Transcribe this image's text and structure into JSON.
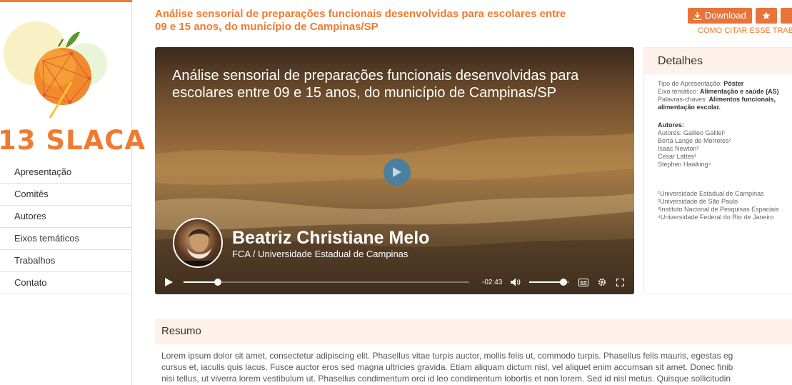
{
  "sidebar": {
    "logo_text": "13 SLACA",
    "nav": [
      "Apresentação",
      "Comitês",
      "Autores",
      "Eixos temáticos",
      "Trabalhos",
      "Contato"
    ]
  },
  "header": {
    "title": "Análise sensorial de preparações funcionais desenvolvidas para escolares entre 09 e 15 anos, do município de Campinas/SP",
    "download_label": "Download",
    "cite_label": "COMO CITAR ESSE TRABA"
  },
  "video": {
    "title": "Análise sensorial de preparações funcionais desenvolvidas para escolares entre 09 e 15 anos, do município de Campinas/SP",
    "presenter_name": "Beatriz Christiane Melo",
    "presenter_affiliation": "FCA / Universidade Estadual de Campinas",
    "time_remaining": "-02:43",
    "progress": 0.12,
    "volume": 0.85
  },
  "details": {
    "heading": "Detalhes",
    "tipo_label": "Tipo de Apresentação:",
    "tipo_value": "Pôster",
    "eixo_label": "Eixo temático:",
    "eixo_value": "Alimentação e saúde (AS)",
    "palavras_label": "Palavras-chaves:",
    "palavras_value": "Alimentos funcionais, alimentação escolar.",
    "autores_heading": "Autores:",
    "autores": [
      "Autores: Galileo Galilei¹",
      "Berta Lange de Morretes²",
      "Isaac Newton³",
      "Cesar Lattes¹",
      "Stephen Hawking⁴"
    ],
    "afiliacoes": [
      "¹Universidade Estadual de Campinas",
      "²Universidade de São Paulo",
      "³Instituto Nacional de Pesquisas Espaciais",
      "⁴Universidade Federal do Rio de Janeiro"
    ]
  },
  "resumo": {
    "heading": "Resumo",
    "lines": [
      "Lorem ipsum dolor sit amet, consectetur adipiscing elit. Phasellus vitae turpis auctor, mollis felis ut, commodo turpis. Phasellus felis mauris, egestas eg",
      "cursus et, iaculis quis lacus. Fusce auctor eros sed magna ultricies gravida. Etiam aliquam dictum nisl, vel aliquet enim accumsan sit amet. Donec finib",
      "nisi tellus, ut viverra lorem vestibulum ut. Phasellus condimentum orci id leo condimentum lobortis et non lorem. Sed id nisl metus. Quisque sollicitudin"
    ]
  },
  "colors": {
    "accent": "#f07a30",
    "button": "#e8743a",
    "panel_head": "#fdf1ea"
  }
}
